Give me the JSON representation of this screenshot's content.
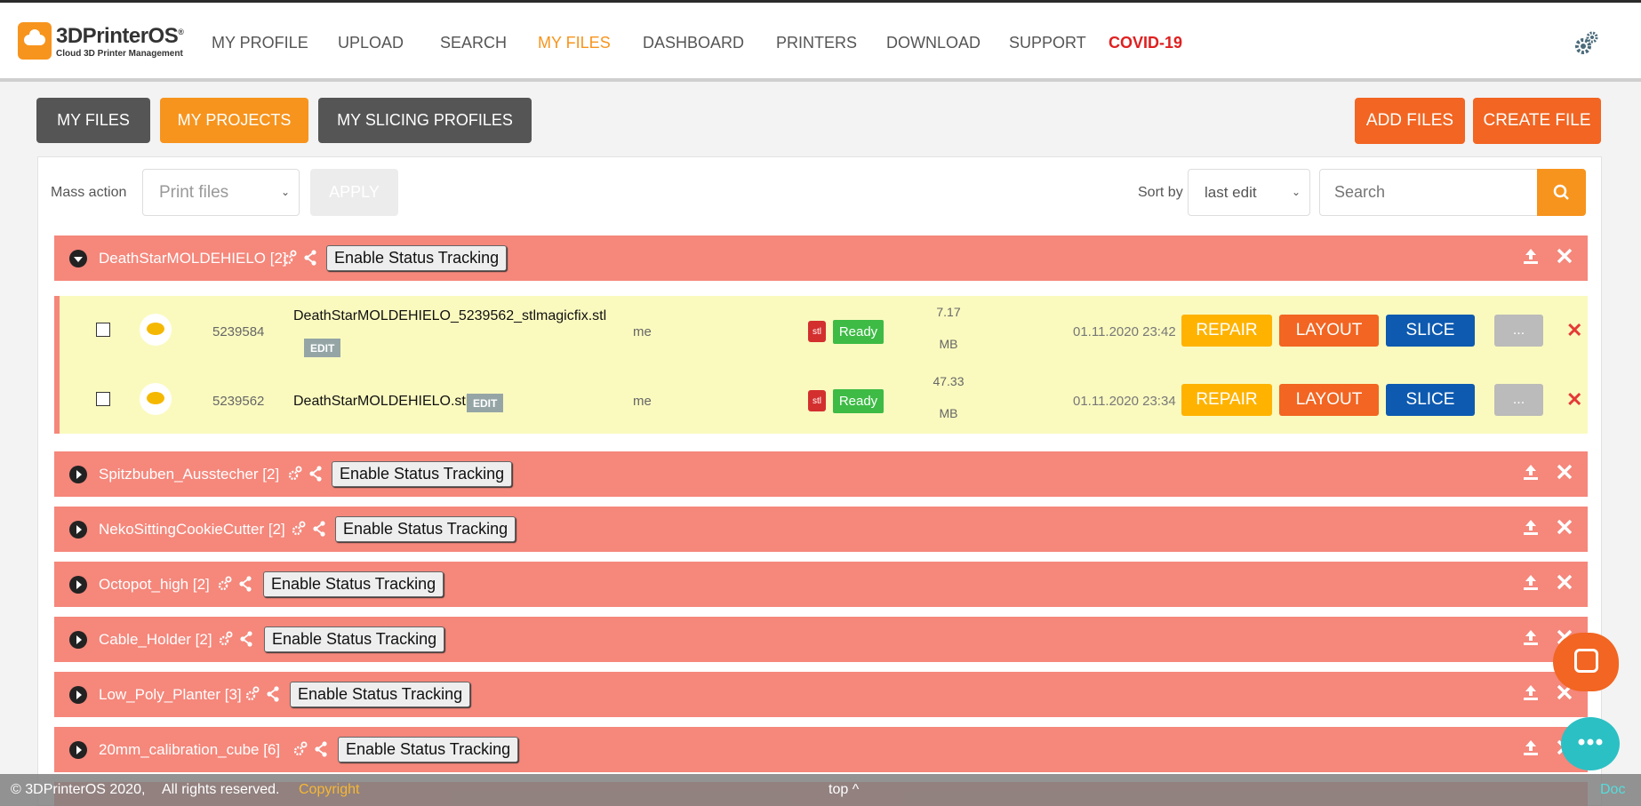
{
  "nav": {
    "logo_title": "3DPrinterOS",
    "logo_trademark": "®",
    "logo_subtitle": "Cloud 3D Printer Management",
    "links": [
      "MY PROFILE",
      "UPLOAD",
      "SEARCH",
      "MY FILES",
      "DASHBOARD",
      "PRINTERS",
      "DOWNLOAD",
      "SUPPORT",
      "COVID-19"
    ],
    "active": "MY FILES"
  },
  "tabs": {
    "my_files": "MY FILES",
    "my_projects": "MY PROJECTS",
    "my_slicing_profiles": "MY SLICING PROFILES"
  },
  "actions": {
    "add_files": "ADD FILES",
    "create_file": "CREATE FILE"
  },
  "toolbar": {
    "mass_action_label": "Mass action",
    "mass_action_value": "Print files",
    "apply_label": "APPLY",
    "sort_label": "Sort by",
    "sort_value": "last edit",
    "search_placeholder": "Search"
  },
  "projects": [
    {
      "name": "DeathStarMOLDEHIELO [2]",
      "tracking": "Enable Status Tracking",
      "expanded": true
    },
    {
      "name": "Spitzbuben_Ausstecher [2]",
      "tracking": "Enable Status Tracking",
      "expanded": false
    },
    {
      "name": "NekoSittingCookieCutter [2]",
      "tracking": "Enable Status Tracking",
      "expanded": false
    },
    {
      "name": "Octopot_high [2]",
      "tracking": "Enable Status Tracking",
      "expanded": false
    },
    {
      "name": "Cable_Holder [2]",
      "tracking": "Enable Status Tracking",
      "expanded": false
    },
    {
      "name": "Low_Poly_Planter [3]",
      "tracking": "Enable Status Tracking",
      "expanded": false
    },
    {
      "name": "20mm_calibration_cube [6]",
      "tracking": "Enable Status Tracking",
      "expanded": false
    }
  ],
  "files": [
    {
      "id": "5239584",
      "name": "DeathStarMOLDEHIELO_5239562_stlmagicfix.stl",
      "edit": "EDIT",
      "owner": "me",
      "type": "stl",
      "status": "Ready",
      "size_value": "7.17",
      "size_unit": "MB",
      "date": "01.11.2020 23:42",
      "repair": "REPAIR",
      "layout": "LAYOUT",
      "slice": "SLICE",
      "more": "...",
      "delete": "✕"
    },
    {
      "id": "5239562",
      "name": "DeathStarMOLDEHIELO.stl",
      "edit": "EDIT",
      "owner": "me",
      "type": "stl",
      "status": "Ready",
      "size_value": "47.33",
      "size_unit": "MB",
      "date": "01.11.2020 23:34",
      "repair": "REPAIR",
      "layout": "LAYOUT",
      "slice": "SLICE",
      "more": "...",
      "delete": "✕"
    }
  ],
  "footer": {
    "copy": "© 3DPrinterOS 2020,",
    "rights": "All rights reserved.",
    "copyright_link": "Copyright",
    "top": "top ^",
    "doc": "Doc"
  },
  "colors": {
    "brand_orange": "#f7941d",
    "project_row": "#f5877b",
    "file_row": "#fafabf",
    "covid": "#e02020"
  }
}
